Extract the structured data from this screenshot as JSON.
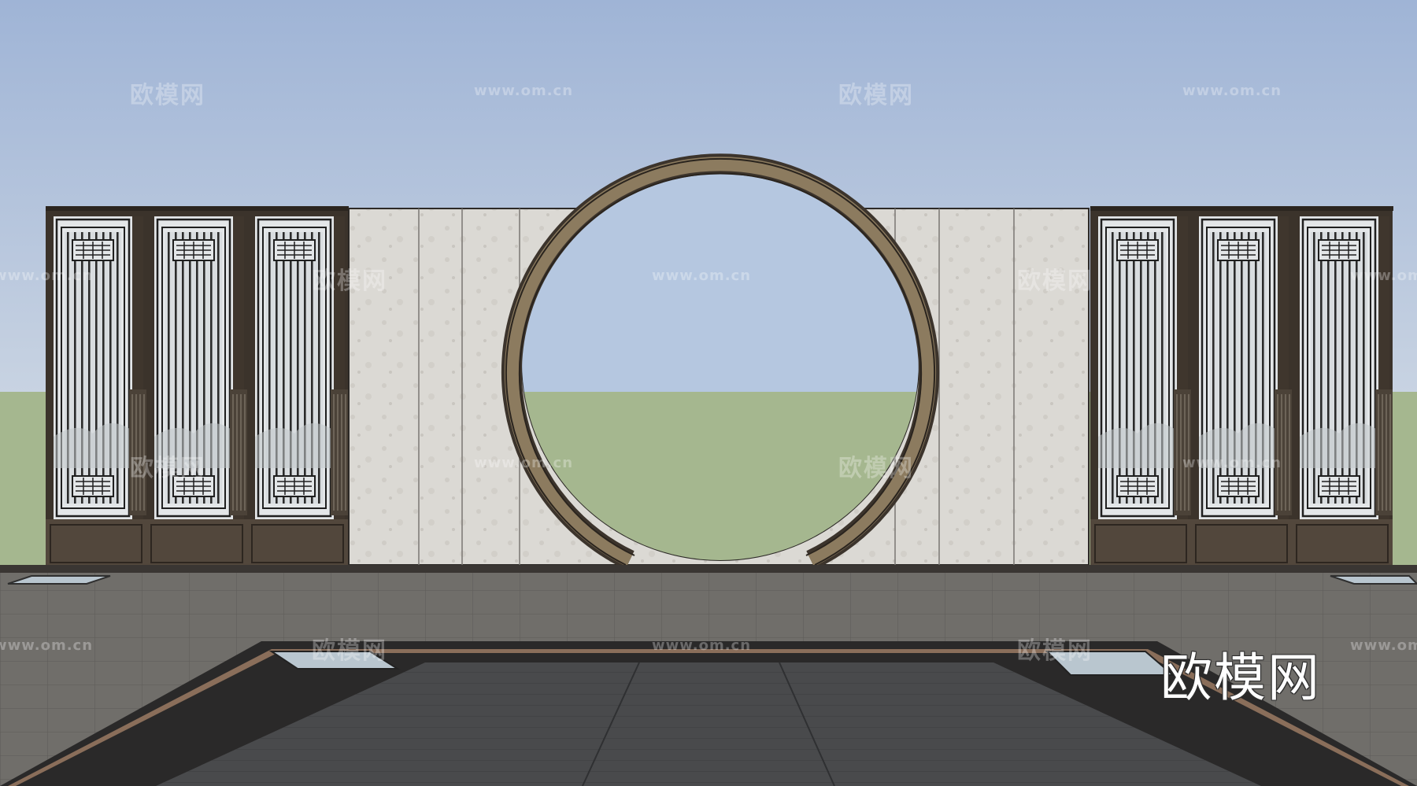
{
  "watermarks": {
    "brand_cn": "欧模网",
    "site_url": "www.om.cn"
  },
  "logo": {
    "text": "欧模网"
  },
  "colors": {
    "sky": "#a9bedc",
    "grass": "#a6b890",
    "wall_stone": "#dcdad6",
    "frame_bronze": "#4a3f33",
    "ring_tan": "#8c7b5f",
    "paving": "#6f6d6a",
    "inner_paving": "#4a4b4d"
  }
}
